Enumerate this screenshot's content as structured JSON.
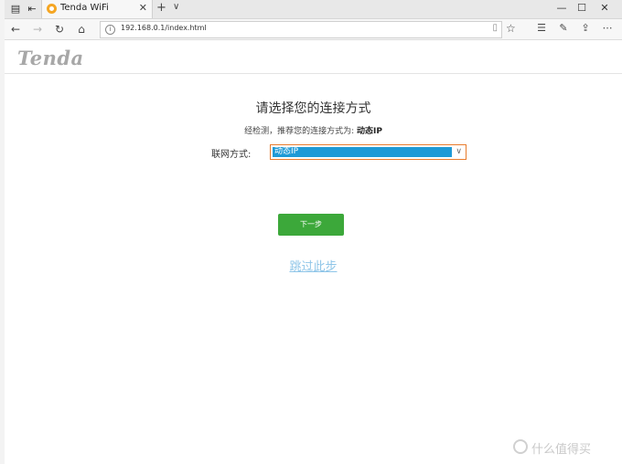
{
  "browser": {
    "tab_title": "Tenda WiFi",
    "url": "192.168.0.1/index.html"
  },
  "header": {
    "logo_text": "Tenda"
  },
  "main": {
    "title": "请选择您的连接方式",
    "detect_prefix": "经检测，推荐您的连接方式为:",
    "detect_value": "动态IP",
    "connection_label": "联网方式:",
    "connection_selected": "动态IP",
    "next_label": "下一步",
    "skip_label": "跳过此步"
  },
  "watermark": {
    "text": "什么值得买"
  },
  "colors": {
    "accent_green": "#3ca83a",
    "select_border": "#e87b2c",
    "selection_blue": "#1e9ad6",
    "link_blue": "#8ec5e8"
  }
}
